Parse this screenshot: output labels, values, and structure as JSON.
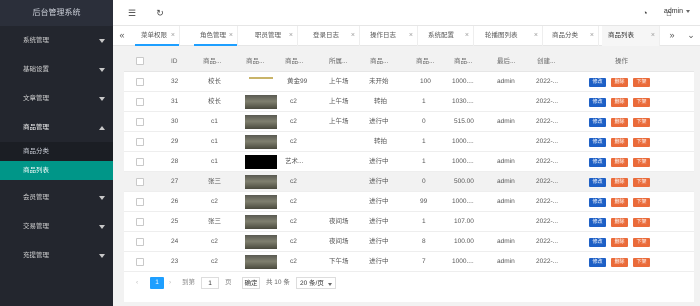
{
  "app": {
    "title": "后台管理系统"
  },
  "sidebar": {
    "items": [
      {
        "label": "系统管理"
      },
      {
        "label": "基础设置"
      },
      {
        "label": "文章管理"
      },
      {
        "label": "商品管理"
      },
      {
        "label": "会员管理"
      },
      {
        "label": "交易管理"
      },
      {
        "label": "充提管理"
      }
    ],
    "sub_items": [
      {
        "label": "商品分类"
      },
      {
        "label": "商品列表"
      }
    ]
  },
  "header": {
    "menu_icon": "menu-icon",
    "refresh_icon": "refresh-icon",
    "theme_icon": "palette-icon",
    "tag_icon": "tag-icon",
    "user": "admin"
  },
  "tabs": [
    {
      "label": "菜单权限"
    },
    {
      "label": "角色管理"
    },
    {
      "label": "职员管理"
    },
    {
      "label": "登录日志"
    },
    {
      "label": "操作日志"
    },
    {
      "label": "系统配置"
    },
    {
      "label": "轮播图列表"
    },
    {
      "label": "商品分类"
    },
    {
      "label": "商品列表"
    }
  ],
  "table": {
    "headers": [
      "ID",
      "商品...",
      "商品...",
      "商品...",
      "所属...",
      "商品...",
      "商品...",
      "商品...",
      "最后...",
      "创建...",
      "操作"
    ],
    "rows": [
      {
        "id": "32",
        "c1": "校长",
        "c3": "黄金99",
        "c4": "上午场",
        "c5": "未开始",
        "c6": "100",
        "c7": "1000....",
        "c8": "admin",
        "c9": "2022-..."
      },
      {
        "id": "31",
        "c1": "校长",
        "c3": "c2",
        "c4": "上午场",
        "c5": "转拍",
        "c6": "1",
        "c7": "1030....",
        "c8": "",
        "c9": "2022-..."
      },
      {
        "id": "30",
        "c1": "c1",
        "c3": "c2",
        "c4": "上午场",
        "c5": "进行中",
        "c6": "0",
        "c7": "515.00",
        "c8": "admin",
        "c9": "2022-..."
      },
      {
        "id": "29",
        "c1": "c1",
        "c3": "c2",
        "c4": "",
        "c5": "转拍",
        "c6": "1",
        "c7": "1000....",
        "c8": "",
        "c9": "2022-..."
      },
      {
        "id": "28",
        "c1": "c1",
        "c3": "艺术...",
        "c4": "",
        "c5": "进行中",
        "c6": "1",
        "c7": "1000....",
        "c8": "admin",
        "c9": "2022-..."
      },
      {
        "id": "27",
        "c1": "张三",
        "c3": "c2",
        "c4": "",
        "c5": "进行中",
        "c6": "0",
        "c7": "500.00",
        "c8": "admin",
        "c9": "2022-..."
      },
      {
        "id": "26",
        "c1": "c2",
        "c3": "c2",
        "c4": "",
        "c5": "进行中",
        "c6": "99",
        "c7": "1000....",
        "c8": "admin",
        "c9": "2022-..."
      },
      {
        "id": "25",
        "c1": "张三",
        "c3": "c2",
        "c4": "夜间场",
        "c5": "进行中",
        "c6": "1",
        "c7": "107.00",
        "c8": "",
        "c9": "2022-..."
      },
      {
        "id": "24",
        "c1": "c2",
        "c3": "c2",
        "c4": "夜间场",
        "c5": "进行中",
        "c6": "8",
        "c7": "100.00",
        "c8": "admin",
        "c9": "2022-..."
      },
      {
        "id": "23",
        "c1": "c2",
        "c3": "c2",
        "c4": "下午场",
        "c5": "进行中",
        "c6": "7",
        "c7": "1000....",
        "c8": "admin",
        "c9": "2022-..."
      }
    ],
    "actions": {
      "edit": "修改",
      "delete": "删除",
      "offline": "下架"
    }
  },
  "pager": {
    "prev": "‹",
    "current": "1",
    "next": "›",
    "goto_label": "到第",
    "page_value": "1",
    "page_unit": "页",
    "confirm": "确定",
    "total": "共 10 条",
    "page_size": "20 条/页"
  }
}
